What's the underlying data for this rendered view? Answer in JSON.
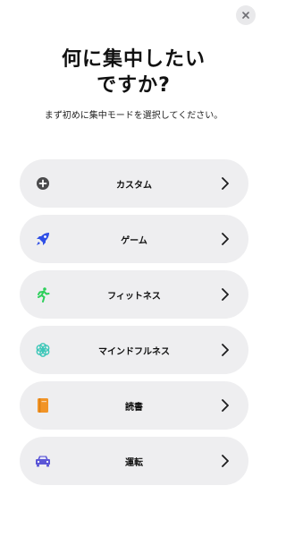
{
  "title_line1": "何に集中したい",
  "title_line2": "ですか?",
  "subtitle": "まず初めに集中モードを選択してください。",
  "close_icon": "xmark-icon",
  "items": [
    {
      "label": "カスタム",
      "icon": "plus-circle-icon",
      "color": "#4a4a4c"
    },
    {
      "label": "ゲーム",
      "icon": "rocket-icon",
      "color": "#2f4fe6"
    },
    {
      "label": "フィットネス",
      "icon": "running-icon",
      "color": "#2ecf5b"
    },
    {
      "label": "マインドフルネス",
      "icon": "flower-icon",
      "color": "#3cc7b8"
    },
    {
      "label": "読書",
      "icon": "book-icon",
      "color": "#f19427"
    },
    {
      "label": "運転",
      "icon": "car-icon",
      "color": "#5b56d6"
    }
  ]
}
